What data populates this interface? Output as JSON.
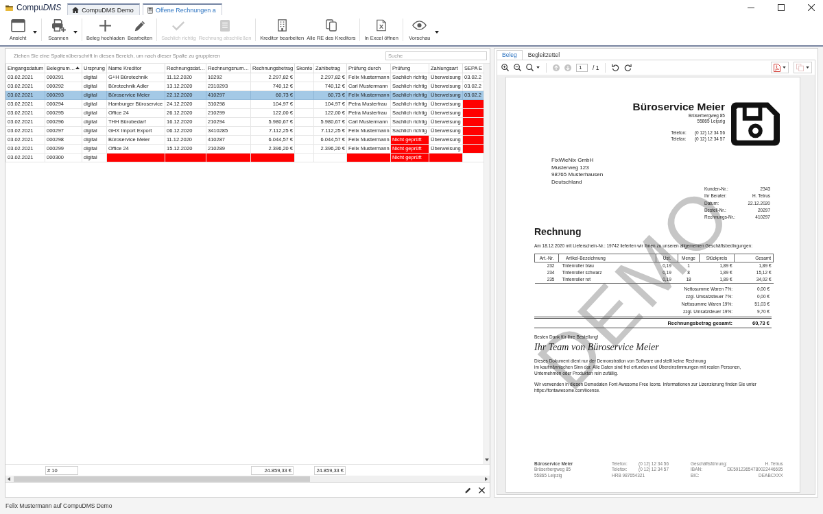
{
  "window": {
    "app_name": [
      {
        "text": "Compu",
        "italic": false
      },
      {
        "text": "DMS",
        "italic": true
      }
    ],
    "tabs": [
      {
        "label": "CompuDMS Demo",
        "selected": false
      },
      {
        "label": "Offene Rechnungen a",
        "selected": true
      }
    ]
  },
  "toolbar": {
    "groups": [
      {
        "items": [
          {
            "label": "Ansicht",
            "disabled": false,
            "dropdown": true
          }
        ]
      },
      {
        "items": [
          {
            "label": "Scannen",
            "disabled": false,
            "dropdown": true
          }
        ]
      },
      {
        "items": [
          {
            "label": "Beleg hochladen",
            "disabled": false,
            "dropdown": false
          },
          {
            "label": "Bearbeiten",
            "disabled": false,
            "dropdown": false
          }
        ]
      },
      {
        "items": [
          {
            "label": "Sachlich richtig",
            "disabled": true,
            "dropdown": false
          },
          {
            "label": "Rechnung abschließen",
            "disabled": true,
            "dropdown": false
          }
        ]
      },
      {
        "items": [
          {
            "label": "Kreditor bearbeiten",
            "disabled": false,
            "dropdown": false
          },
          {
            "label": "Alle RE des Kreditors",
            "disabled": false,
            "dropdown": false
          }
        ]
      },
      {
        "items": [
          {
            "label": "In Excel öffnen",
            "disabled": false,
            "dropdown": false
          }
        ]
      },
      {
        "items": [
          {
            "label": "Vorschau",
            "disabled": false,
            "dropdown": true
          }
        ]
      }
    ]
  },
  "grid": {
    "group_hint": "Ziehen Sie eine Spaltenüberschrift in diesen Bereich, um nach dieser Spalte zu gruppieren",
    "search": {
      "placeholder": "Suche"
    },
    "columns": [
      {
        "label": "Eingangsdatum",
        "kind": "text",
        "sorted": false
      },
      {
        "label": "Belegnum…",
        "kind": "text",
        "sorted": true,
        "total": "# 10"
      },
      {
        "label": "Ursprung",
        "kind": "text",
        "sorted": false
      },
      {
        "label": "Name Kreditor",
        "kind": "text",
        "sorted": false
      },
      {
        "label": "Rechnungsdat…",
        "kind": "text",
        "sorted": false
      },
      {
        "label": "Rechnungsnum…",
        "kind": "text",
        "sorted": false
      },
      {
        "label": "Rechnungsbetrag",
        "kind": "amount",
        "sorted": false,
        "total": "24.859,33 €"
      },
      {
        "label": "Skonto",
        "kind": "text",
        "sorted": false
      },
      {
        "label": "Zahlbetrag",
        "kind": "amount",
        "sorted": false,
        "total": "24.859,33 €"
      },
      {
        "label": "Prüfung durch",
        "kind": "text",
        "sorted": false
      },
      {
        "label": "Prüfung",
        "kind": "text",
        "sorted": false
      },
      {
        "label": "Zahlungsart",
        "kind": "text",
        "sorted": false
      },
      {
        "label": "SEPA E",
        "kind": "text",
        "sorted": false
      }
    ],
    "rows": [
      {
        "selected": false,
        "cells": [
          {
            "text": "03.02.2021",
            "flagged": false
          },
          {
            "text": "000291",
            "flagged": false
          },
          {
            "text": "digital",
            "flagged": false
          },
          {
            "text": "G+H Bürotechnik",
            "flagged": false
          },
          {
            "text": "11.12.2020",
            "flagged": false
          },
          {
            "text": "10292",
            "flagged": false
          },
          {
            "text": "2.297,82 €",
            "flagged": false
          },
          {
            "flagged": false
          },
          {
            "text": "2.297,82 €",
            "flagged": false
          },
          {
            "text": "Felix Mustermann",
            "flagged": false
          },
          {
            "text": "Sachlich richtig",
            "flagged": false
          },
          {
            "text": "Überweisung",
            "flagged": false
          },
          {
            "text": "03.02.2",
            "flagged": false
          }
        ]
      },
      {
        "selected": false,
        "cells": [
          {
            "text": "03.02.2021",
            "flagged": false
          },
          {
            "text": "000292",
            "flagged": false
          },
          {
            "text": "digital",
            "flagged": false
          },
          {
            "text": "Bürotechnik Adler",
            "flagged": false
          },
          {
            "text": "13.12.2020",
            "flagged": false
          },
          {
            "text": "2310293",
            "flagged": false
          },
          {
            "text": "740,12 €",
            "flagged": false
          },
          {
            "flagged": false
          },
          {
            "text": "740,12 €",
            "flagged": false
          },
          {
            "text": "Carl Mustermann",
            "flagged": false
          },
          {
            "text": "Sachlich richtig",
            "flagged": false
          },
          {
            "text": "Überweisung",
            "flagged": false
          },
          {
            "text": "03.02.2",
            "flagged": false
          }
        ]
      },
      {
        "selected": true,
        "cells": [
          {
            "text": "03.02.2021",
            "flagged": false
          },
          {
            "text": "000293",
            "flagged": false
          },
          {
            "text": "digital",
            "flagged": false
          },
          {
            "text": "Büroservice Meier",
            "flagged": false
          },
          {
            "text": "22.12.2020",
            "flagged": false
          },
          {
            "text": "410297",
            "flagged": false
          },
          {
            "text": "60,73 €",
            "flagged": false
          },
          {
            "flagged": false
          },
          {
            "text": "60,73 €",
            "flagged": false
          },
          {
            "text": "Felix Mustermann",
            "flagged": false
          },
          {
            "text": "Sachlich richtig",
            "flagged": false
          },
          {
            "text": "Überweisung",
            "flagged": false
          },
          {
            "text": "03.02.2",
            "flagged": false
          }
        ]
      },
      {
        "selected": false,
        "cells": [
          {
            "text": "03.02.2021",
            "flagged": false
          },
          {
            "text": "000294",
            "flagged": false
          },
          {
            "text": "digital",
            "flagged": false
          },
          {
            "text": "Hamburger Büroservice",
            "flagged": false
          },
          {
            "text": "24.12.2020",
            "flagged": false
          },
          {
            "text": "310298",
            "flagged": false
          },
          {
            "text": "104,97 €",
            "flagged": false
          },
          {
            "flagged": false
          },
          {
            "text": "104,97 €",
            "flagged": false
          },
          {
            "text": "Petra Musterfrau",
            "flagged": false
          },
          {
            "text": "Sachlich richtig",
            "flagged": false
          },
          {
            "text": "Überweisung",
            "flagged": false
          },
          {
            "flagged": true
          }
        ]
      },
      {
        "selected": false,
        "cells": [
          {
            "text": "03.02.2021",
            "flagged": false
          },
          {
            "text": "000295",
            "flagged": false
          },
          {
            "text": "digital",
            "flagged": false
          },
          {
            "text": "Office 24",
            "flagged": false
          },
          {
            "text": "26.12.2020",
            "flagged": false
          },
          {
            "text": "210299",
            "flagged": false
          },
          {
            "text": "122,00 €",
            "flagged": false
          },
          {
            "flagged": false
          },
          {
            "text": "122,00 €",
            "flagged": false
          },
          {
            "text": "Petra Musterfrau",
            "flagged": false
          },
          {
            "text": "Sachlich richtig",
            "flagged": false
          },
          {
            "text": "Überweisung",
            "flagged": false
          },
          {
            "flagged": true
          }
        ]
      },
      {
        "selected": false,
        "cells": [
          {
            "text": "03.02.2021",
            "flagged": false
          },
          {
            "text": "000296",
            "flagged": false
          },
          {
            "text": "digital",
            "flagged": false
          },
          {
            "text": "THH Bürobedarf",
            "flagged": false
          },
          {
            "text": "16.12.2020",
            "flagged": false
          },
          {
            "text": "210294",
            "flagged": false
          },
          {
            "text": "5.980,67 €",
            "flagged": false
          },
          {
            "flagged": false
          },
          {
            "text": "5.980,67 €",
            "flagged": false
          },
          {
            "text": "Carl Mustermann",
            "flagged": false
          },
          {
            "text": "Sachlich richtig",
            "flagged": false
          },
          {
            "text": "Überweisung",
            "flagged": false
          },
          {
            "flagged": true
          }
        ]
      },
      {
        "selected": false,
        "cells": [
          {
            "text": "03.02.2021",
            "flagged": false
          },
          {
            "text": "000297",
            "flagged": false
          },
          {
            "text": "digital",
            "flagged": false
          },
          {
            "text": "GHX Import Export",
            "flagged": false
          },
          {
            "text": "06.12.2020",
            "flagged": false
          },
          {
            "text": "3410285",
            "flagged": false
          },
          {
            "text": "7.112,25 €",
            "flagged": false
          },
          {
            "flagged": false
          },
          {
            "text": "7.112,25 €",
            "flagged": false
          },
          {
            "text": "Felix Mustermann",
            "flagged": false
          },
          {
            "text": "Sachlich richtig",
            "flagged": false
          },
          {
            "text": "Überweisung",
            "flagged": false
          },
          {
            "flagged": true
          }
        ]
      },
      {
        "selected": false,
        "cells": [
          {
            "text": "03.02.2021",
            "flagged": false
          },
          {
            "text": "000298",
            "flagged": false
          },
          {
            "text": "digital",
            "flagged": false
          },
          {
            "text": "Büroservice Meier",
            "flagged": false
          },
          {
            "text": "11.12.2020",
            "flagged": false
          },
          {
            "text": "410287",
            "flagged": false
          },
          {
            "text": "6.044,57 €",
            "flagged": false
          },
          {
            "flagged": false
          },
          {
            "text": "6.044,57 €",
            "flagged": false
          },
          {
            "text": "Felix Mustermann",
            "flagged": false
          },
          {
            "text": "Nicht geprüft",
            "flagged": true
          },
          {
            "text": "Überweisung",
            "flagged": false
          },
          {
            "flagged": true
          }
        ]
      },
      {
        "selected": false,
        "cells": [
          {
            "text": "03.02.2021",
            "flagged": false
          },
          {
            "text": "000299",
            "flagged": false
          },
          {
            "text": "digital",
            "flagged": false
          },
          {
            "text": "Office 24",
            "flagged": false
          },
          {
            "text": "15.12.2020",
            "flagged": false
          },
          {
            "text": "210289",
            "flagged": false
          },
          {
            "text": "2.396,20 €",
            "flagged": false
          },
          {
            "flagged": false
          },
          {
            "text": "2.396,20 €",
            "flagged": false
          },
          {
            "text": "Felix Mustermann",
            "flagged": false
          },
          {
            "text": "Nicht geprüft",
            "flagged": true
          },
          {
            "text": "Überweisung",
            "flagged": false
          },
          {
            "flagged": true
          }
        ]
      },
      {
        "selected": false,
        "cells": [
          {
            "text": "03.02.2021",
            "flagged": false
          },
          {
            "text": "000300",
            "flagged": false
          },
          {
            "text": "digital",
            "flagged": false
          },
          {
            "flagged": true
          },
          {
            "flagged": true
          },
          {
            "flagged": true
          },
          {
            "flagged": true
          },
          {
            "flagged": false
          },
          {
            "flagged": false
          },
          {
            "flagged": true
          },
          {
            "text": "Nicht geprüft",
            "flagged": true
          },
          {
            "flagged": true
          },
          {
            "flagged": false
          }
        ]
      }
    ]
  },
  "status_bar": {
    "text": "Felix Mustermann auf CompuDMS Demo"
  },
  "preview": {
    "tabs": [
      {
        "label": "Beleg",
        "selected": true
      },
      {
        "label": "Begleitzettel",
        "selected": false
      }
    ],
    "toolbar": {
      "nav": [
        {
          "disabled": true
        },
        {
          "disabled": true
        }
      ],
      "page": "1",
      "page_total": "/ 1",
      "exports": [
        {
          "disabled": false
        },
        {
          "disabled": true
        }
      ]
    },
    "document": {
      "watermark": "DEMO",
      "sender": {
        "name": "Büroservice Meier",
        "address": [
          "Brüserbergweg 85",
          "55865 Leipzig"
        ],
        "contacts": [
          {
            "label": "Telefon:",
            "value": "(0 12) 12 34 56"
          },
          {
            "label": "Telefax:",
            "value": "(0 12) 12 34 57"
          }
        ]
      },
      "recipient": [
        "FixWieNix GmbH",
        "Musterweg 123",
        "98765 Musterhausen",
        "Deutschland"
      ],
      "details": [
        {
          "label": "Kunden-Nr.:",
          "value": "2343"
        },
        {
          "label": "Ihr Berater:",
          "value": "H. Tetrus"
        },
        {
          "label": "Datum:",
          "value": "22.12.2020"
        },
        {
          "label": "Bestell-Nr.:",
          "value": "20297"
        },
        {
          "label": "Rechnungs-Nr.:",
          "value": "410297"
        }
      ],
      "title": "Rechnung",
      "intro": "Am 18.12.2020 mit Lieferschein-Nr.: 19742 lieferten wir Ihnen zu unseren allgemeinen Geschäftsbedingungen:",
      "items": {
        "columns": [
          "Art.-Nr.",
          "Artikel-Bezeichnung",
          "Ust.",
          "Menge",
          "Stückpreis",
          "Gesamt"
        ],
        "rows": [
          [
            "232",
            "Tintenroller blau",
            "0,19",
            "1",
            "1,89 €",
            "1,89 €"
          ],
          [
            "234",
            "Tintenroller schwarz",
            "0,19",
            "8",
            "1,89 €",
            "15,12 €"
          ],
          [
            "235",
            "Tintenroller rot",
            "0,19",
            "18",
            "1,89 €",
            "34,02 €"
          ]
        ]
      },
      "sums": [
        {
          "label": "Nettosumme Waren 7%:",
          "value": "0,00 €"
        },
        {
          "label": "zzgl. Umsatzsteuer 7%:",
          "value": "0,00 €"
        },
        {
          "label": "Nettosumme Waren 19%:",
          "value": "51,03 €"
        },
        {
          "label": "zzgl. Umsatzsteuer 19%:",
          "value": "9,70 €"
        }
      ],
      "total": {
        "label": "Rechnungsbetrag gesamt:",
        "value": "60,73 €"
      },
      "thanks": "Besten Dank für Ihre Bestellung!",
      "signature": "Ihr Team von Büroservice Meier",
      "notes": [
        "Dieses Dokument dient nur der Demonstration von Software und stellt keine Rechnung\nim kaufmännischen Sinn dar. Alle Daten sind frei erfunden und Übereinstimmungen mit realen Personen,\nUnternehmen oder Produkten rein zufällig.",
        "Wir verwenden in diesen Demodaten Font Awesome Free Icons. Informationen zur Lizenzierung finden Sie unter\nhttps://fontawesome.com/license."
      ],
      "footer": {
        "company": {
          "name": "Büroservice Meier",
          "lines": [
            "Brüserbergweg 85",
            "55865 Leipzig"
          ]
        },
        "contact": {
          "lines": [
            {
              "label": "Telefon:",
              "value": "(0 12) 12 34 56"
            },
            {
              "label": "Telefax:",
              "value": "(0 12) 12 34 57"
            }
          ],
          "register": "HRB 987654321"
        },
        "management": [
          {
            "label": "Geschäftsführung:",
            "value": "H. Tetrus"
          },
          {
            "label": "IBAN:",
            "value": "DE59123654780022446695"
          },
          {
            "label": "BIC:",
            "value": "DEABCXXX"
          }
        ]
      }
    }
  }
}
